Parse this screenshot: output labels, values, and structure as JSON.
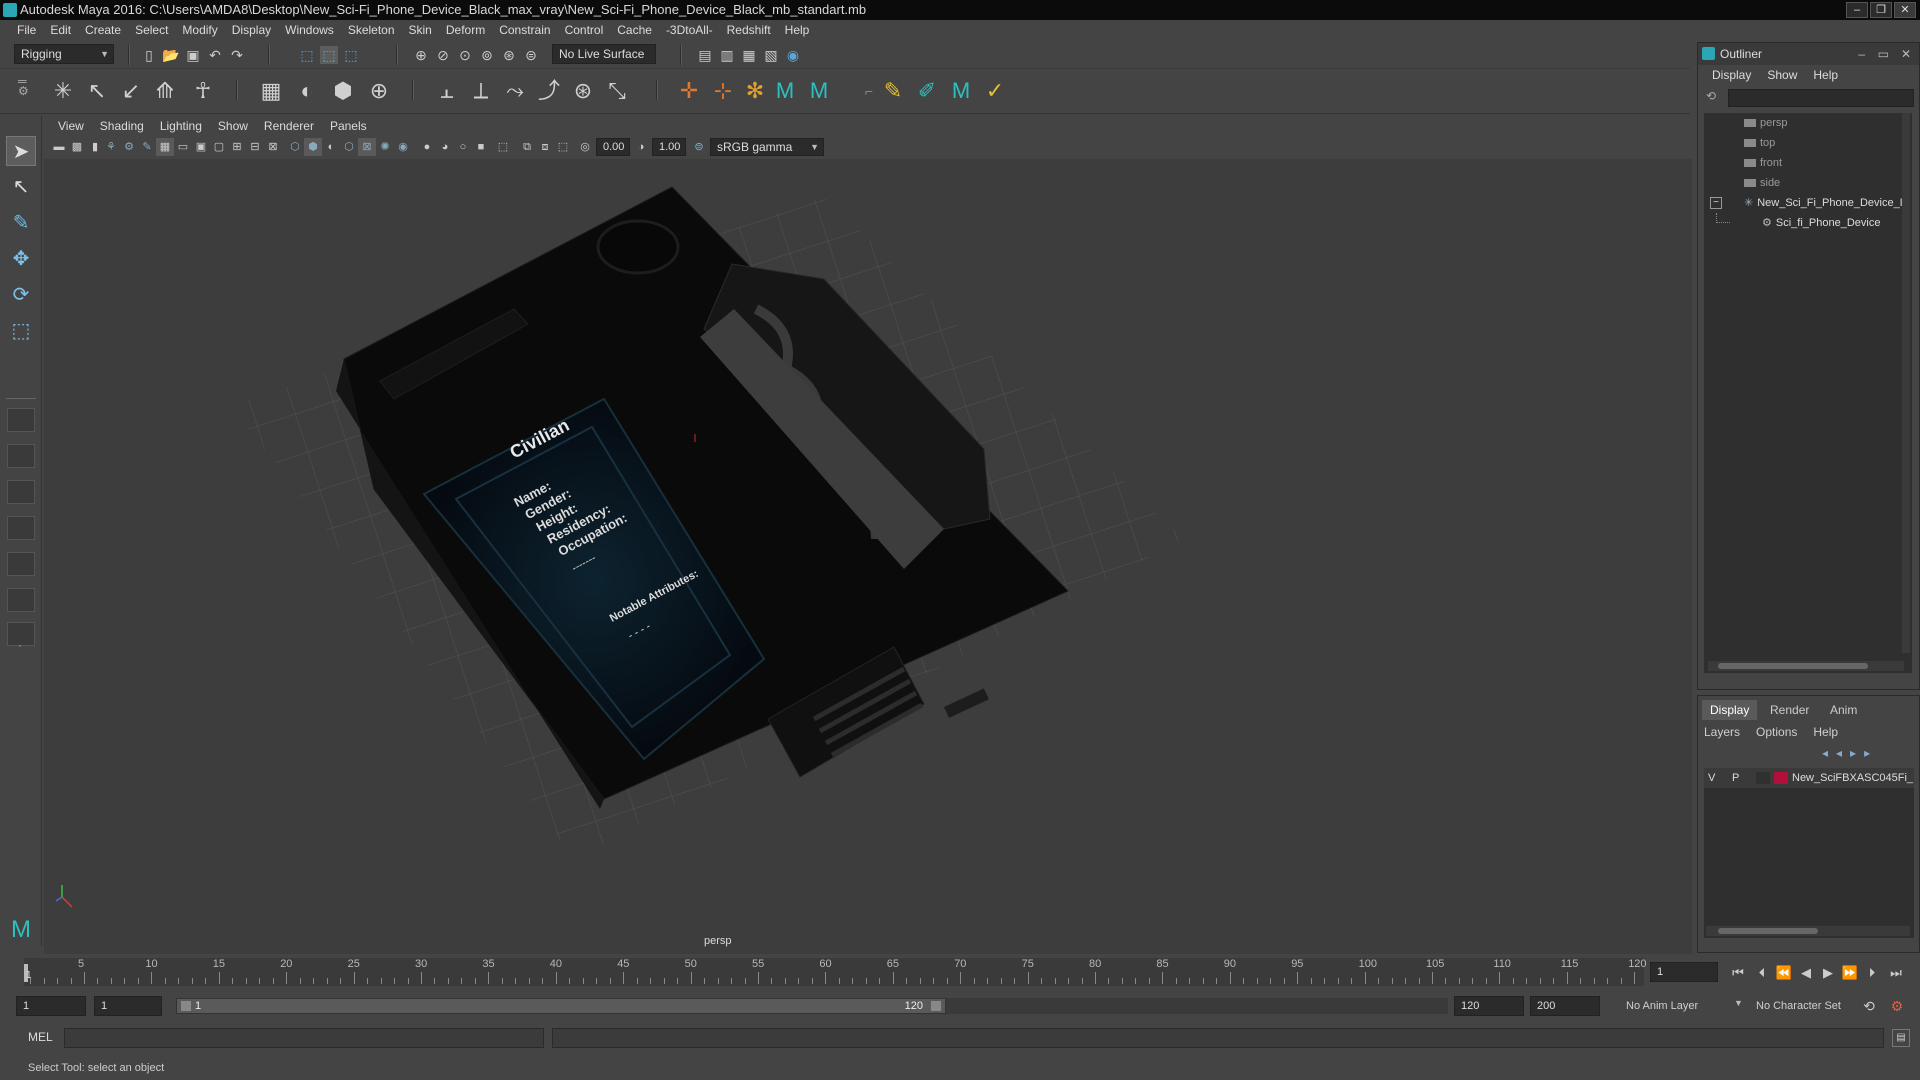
{
  "window": {
    "title": "Autodesk Maya 2016: C:\\Users\\AMDA8\\Desktop\\New_Sci-Fi_Phone_Device_Black_max_vray\\New_Sci-Fi_Phone_Device_Black_mb_standart.mb",
    "minimize": "–",
    "restore": "❐",
    "close": "✕"
  },
  "menubar": [
    "File",
    "Edit",
    "Create",
    "Select",
    "Modify",
    "Display",
    "Windows",
    "Skeleton",
    "Skin",
    "Deform",
    "Constrain",
    "Control",
    "Cache",
    "-3DtoAll-",
    "Redshift",
    "Help"
  ],
  "statusline": {
    "menuset": "Rigging",
    "live_surface": "No Live Surface"
  },
  "viewport": {
    "menu": [
      "View",
      "Shading",
      "Lighting",
      "Show",
      "Renderer",
      "Panels"
    ],
    "exposure": "0.00",
    "gamma": "1.00",
    "colorspace": "sRGB gamma",
    "camera_label": "persp",
    "id_card": {
      "title": "Civilian",
      "fields": [
        "Name:",
        "Gender:",
        "Height:",
        "Residency:",
        "Occupation:"
      ],
      "dashes": "-------",
      "notable": "Notable Attributes:",
      "marks": "- - - -"
    }
  },
  "outliner": {
    "title": "Outliner",
    "menu": [
      "Display",
      "Show",
      "Help"
    ],
    "items": [
      {
        "label": "persp"
      },
      {
        "label": "top"
      },
      {
        "label": "front"
      },
      {
        "label": "side"
      },
      {
        "label": "New_Sci_Fi_Phone_Device_I"
      },
      {
        "label": "Sci_fi_Phone_Device"
      }
    ],
    "collapse_sign": "−"
  },
  "layer_editor": {
    "tabs": [
      "Display",
      "Render",
      "Anim"
    ],
    "menu": [
      "Layers",
      "Options",
      "Help"
    ],
    "layer": {
      "v": "V",
      "p": "P",
      "name": "New_SciFBXASC045Fi_",
      "color": "#b0103a"
    }
  },
  "timeline": {
    "ticks": [
      "5",
      "10",
      "15",
      "20",
      "25",
      "30",
      "35",
      "40",
      "45",
      "50",
      "55",
      "60",
      "65",
      "70",
      "75",
      "80",
      "85",
      "90",
      "95",
      "100",
      "105",
      "110",
      "115",
      "120"
    ],
    "start_marker": "1",
    "current_frame": "1"
  },
  "range": {
    "start": "1",
    "playback_start": "1",
    "slider_start": "1",
    "slider_end": "120",
    "playback_end": "120",
    "end": "200",
    "anim_layer": "No Anim Layer",
    "character_set": "No Character Set"
  },
  "command": {
    "label": "MEL"
  },
  "help_line": "Select Tool: select an object"
}
